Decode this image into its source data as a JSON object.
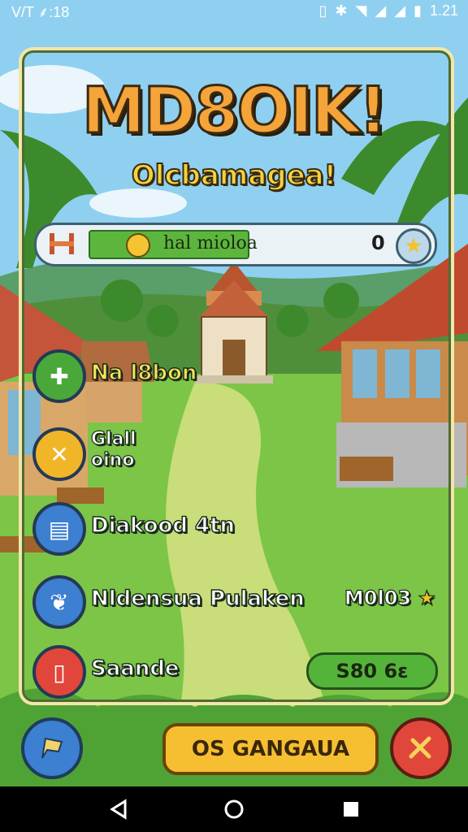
{
  "status": {
    "left_text": "V/T ⸙:18",
    "right_text": "1.21"
  },
  "game": {
    "title": "MD8OIK!",
    "subtitle": "Olcbamagea!",
    "progress": {
      "label": "hal mioloa",
      "count": "0",
      "fraction": 0.72
    },
    "menu": [
      {
        "label": "Na l8bon",
        "icon": "bandage-icon",
        "color": "#4aa83a"
      },
      {
        "label": "Glall\noino",
        "icon": "hammer-icon",
        "color": "#f0b628"
      },
      {
        "label": "Diakood  4tn",
        "icon": "notepad-icon",
        "color": "#3d7fd0"
      },
      {
        "label": "Nldensua Pulaken",
        "icon": "leaf-icon",
        "color": "#3d7fd0",
        "reward": "M0l03"
      },
      {
        "label": "Saande",
        "icon": "phone-icon",
        "color": "#e0473a"
      }
    ],
    "green_button": "S80 6ɛ",
    "main_button": "OS GANGAUA"
  },
  "colors": {
    "accent_green": "#5cb63e",
    "accent_yellow": "#f6bf32",
    "accent_red": "#e0473a",
    "accent_blue": "#3d7fd0"
  }
}
